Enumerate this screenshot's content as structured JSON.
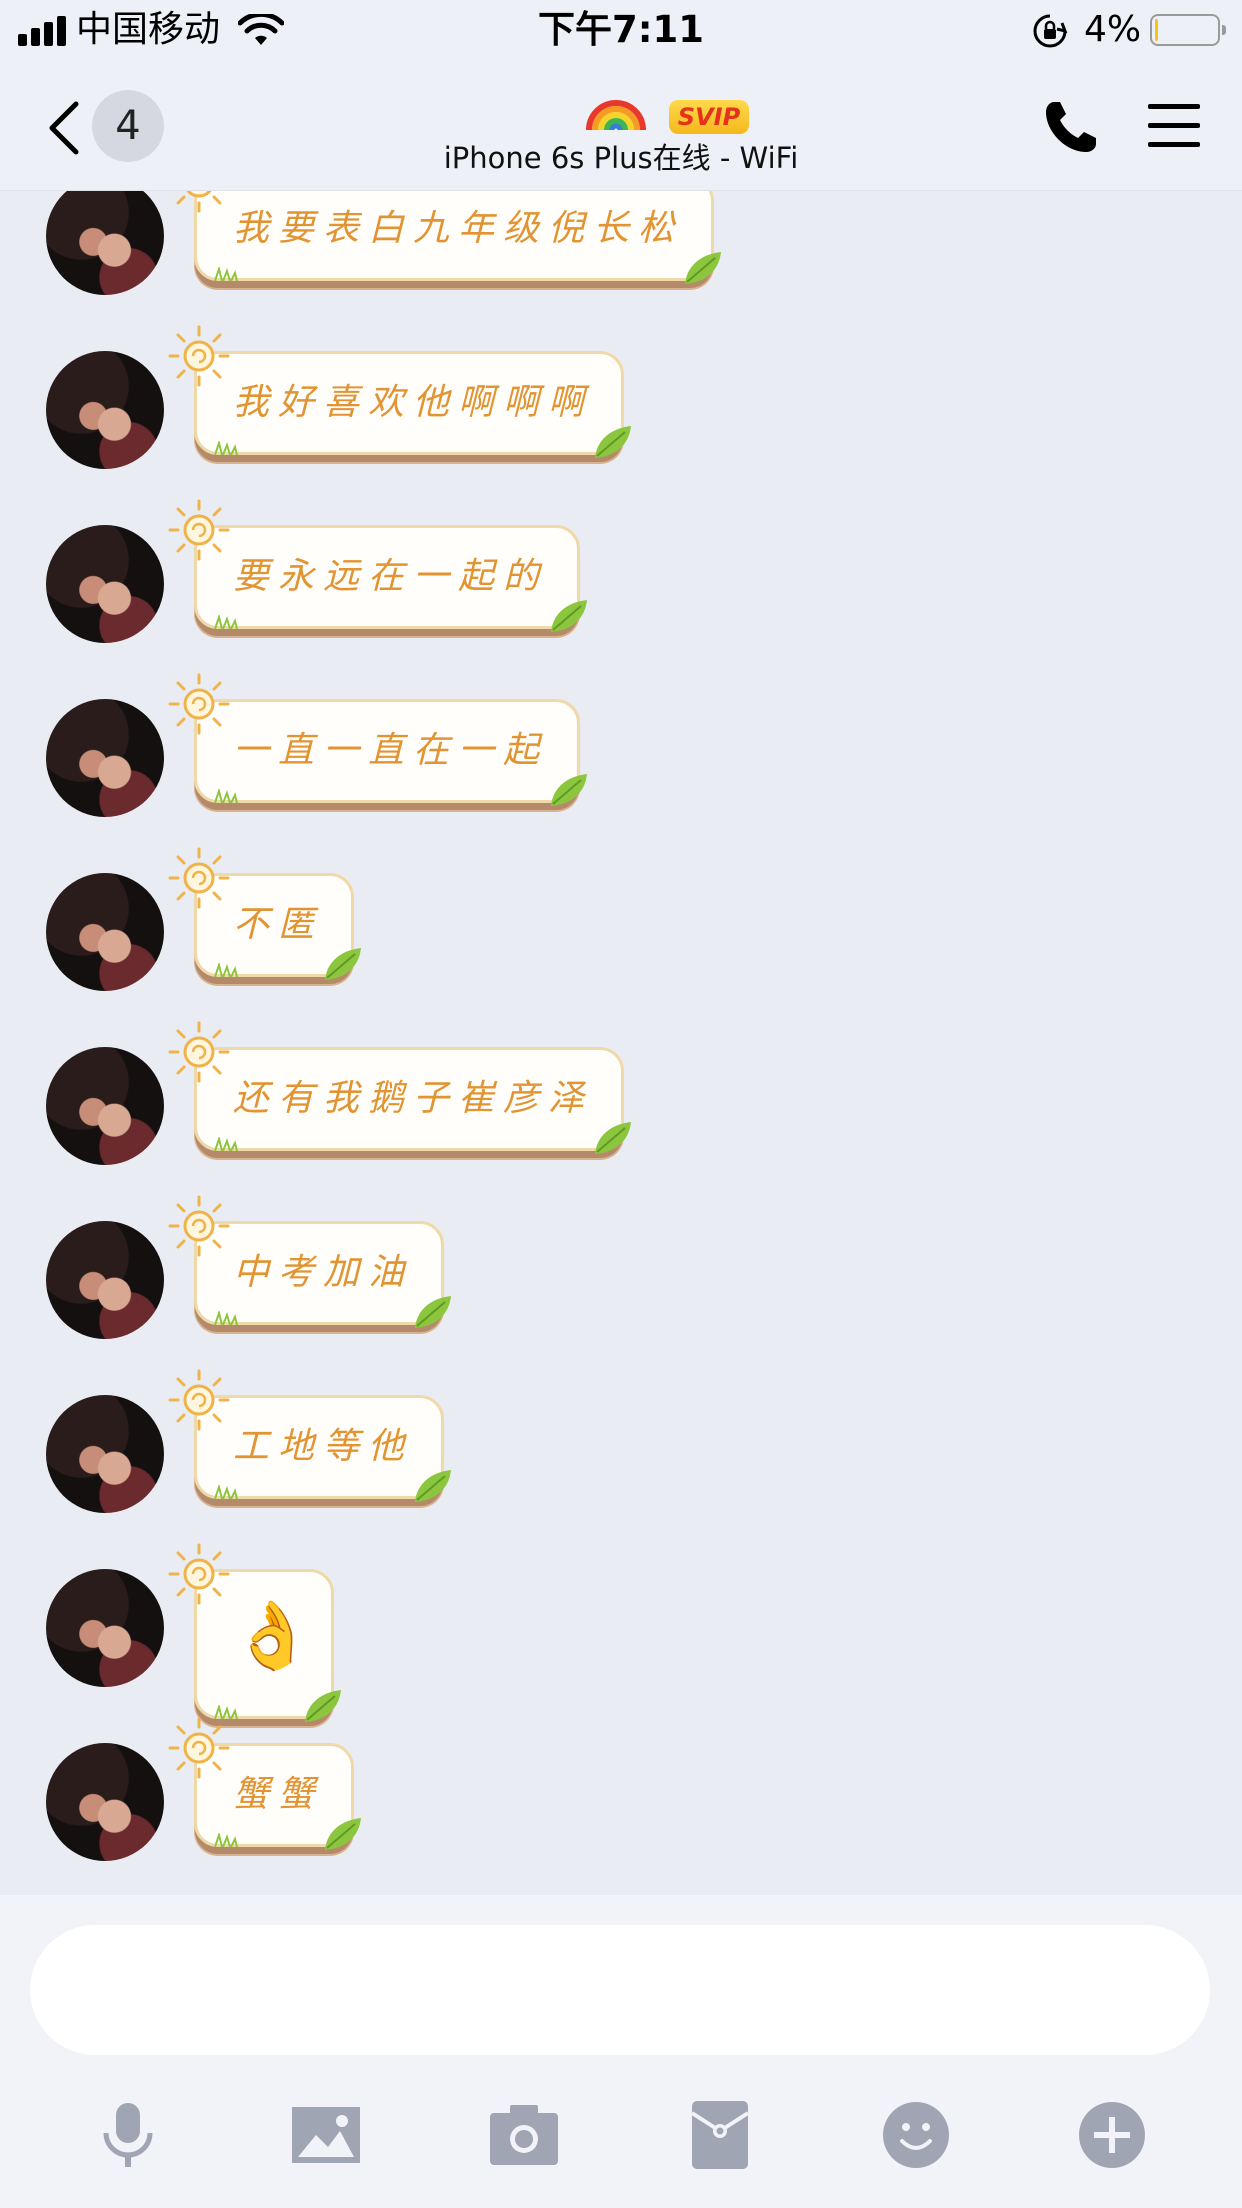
{
  "status_bar": {
    "carrier": "中国移动",
    "time": "下午7:11",
    "battery_percent": "4%",
    "battery_level": 0.04,
    "icons": [
      "signal-icon",
      "wifi-icon",
      "rotation-lock-icon",
      "battery-icon"
    ]
  },
  "header": {
    "back_unread_count": "4",
    "badge": "SVIP",
    "subtitle": "iPhone 6s Plus在线 - WiFi",
    "icons": [
      "back-chevron-icon",
      "rainbow-icon",
      "phone-icon",
      "menu-icon"
    ]
  },
  "messages": [
    {
      "text": "我要表白九年级倪长松"
    },
    {
      "text": "我好喜欢他啊啊啊"
    },
    {
      "text": "要永远在一起的"
    },
    {
      "text": "一直一直在一起"
    },
    {
      "text": "不匿"
    },
    {
      "text": "还有我鹅子崔彦泽"
    },
    {
      "text": "中考加油"
    },
    {
      "text": "工地等他"
    },
    {
      "emoji": "👌"
    },
    {
      "text": "蟹蟹"
    }
  ],
  "input": {
    "placeholder": "",
    "value": ""
  },
  "toolbar": {
    "icons": [
      "microphone-icon",
      "image-icon",
      "camera-icon",
      "red-packet-icon",
      "emoji-icon",
      "plus-icon"
    ]
  },
  "colors": {
    "bubble_text": "#e29433",
    "bubble_border": "#f0d9a9",
    "svip_red": "#e4321c",
    "toolbar_icon": "#9fa5b3",
    "chat_background": "#eaecf4"
  }
}
